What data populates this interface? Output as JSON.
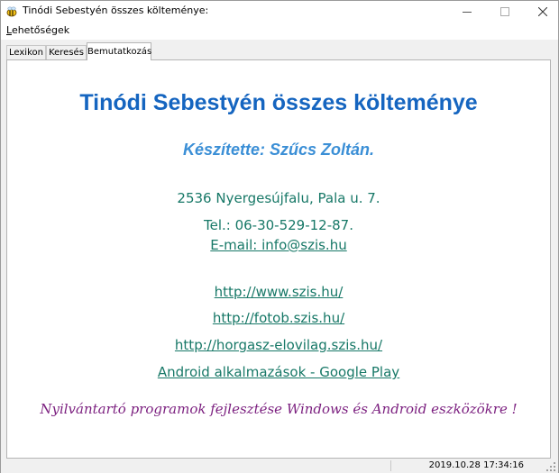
{
  "window": {
    "title": "Tinódi Sebestyén összes költeménye:",
    "icon": "bee-icon"
  },
  "menu": {
    "items": [
      {
        "label_underlined": "L",
        "label_rest": "ehetőségek"
      }
    ]
  },
  "tabs": [
    {
      "label": "Lexikon",
      "active": false
    },
    {
      "label": "Keresés",
      "active": false
    },
    {
      "label": "Bemutatkozás",
      "active": true
    }
  ],
  "intro": {
    "heading": "Tinódi Sebestyén összes költeménye",
    "author": "Készítette: Szűcs Zoltán.",
    "address": "2536 Nyergesújfalu, Pala u. 7.",
    "phone": "Tel.: 06-30-529-12-87.",
    "email": "E-mail: info@szis.hu",
    "links": [
      "http://www.szis.hu/",
      "http://fotob.szis.hu/",
      "http://horgasz-elovilag.szis.hu/",
      "Android alkalmazások - Google Play "
    ],
    "tagline": "Nyilvántartó programok fejlesztése Windows és Android eszközökre !"
  },
  "status": {
    "timestamp": "2019.10.28 17:34:16"
  },
  "colors": {
    "heading": "#1565c0",
    "author": "#3b8fd6",
    "contact": "#177867",
    "tagline": "#7b1f7f"
  }
}
